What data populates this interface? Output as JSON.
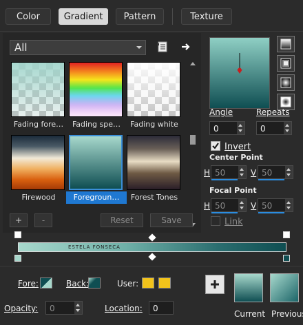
{
  "tabs": [
    {
      "label": "Color"
    },
    {
      "label": "Gradient"
    },
    {
      "label": "Pattern"
    },
    {
      "label": "Texture"
    }
  ],
  "active_tab": "Gradient",
  "preset": {
    "selected": "All"
  },
  "presets": [
    {
      "label": "Fading fore…"
    },
    {
      "label": "Fading spe…"
    },
    {
      "label": "Fading white"
    },
    {
      "label": "Firewood"
    },
    {
      "label": "Foregroun…",
      "selected": true
    },
    {
      "label": "Forest Tones"
    }
  ],
  "preset_buttons": {
    "add": "+",
    "remove": "-",
    "reset": "Reset",
    "save": "Save"
  },
  "controls": {
    "angle_label": "Angle",
    "angle_value": "0",
    "repeats_label": "Repeats",
    "repeats_value": "0",
    "invert_label": "Invert",
    "invert_checked": true,
    "center_point_label": "Center Point",
    "center_h_label": "H",
    "center_h_value": "50",
    "center_v_label": "V",
    "center_v_value": "50",
    "focal_point_label": "Focal Point",
    "focal_h_label": "H",
    "focal_h_value": "50",
    "focal_v_label": "V",
    "focal_v_value": "50",
    "link_label": "Link",
    "link_checked": false
  },
  "gradient_bar": {
    "text": "ESTELA FONSECA"
  },
  "bottom": {
    "fore_label": "Fore:",
    "back_label": "Back:",
    "user_label": "User:",
    "opacity_label": "Opacity:",
    "opacity_value": "0",
    "location_label": "Location:",
    "location_value": "0",
    "current_label": "Current",
    "previous_label": "Previous"
  },
  "colors": {
    "accent": "#1f78d1",
    "user_swatch": "#f2c31b",
    "gradient_light": "#a7d8cc",
    "gradient_dark": "#0f4e52"
  }
}
